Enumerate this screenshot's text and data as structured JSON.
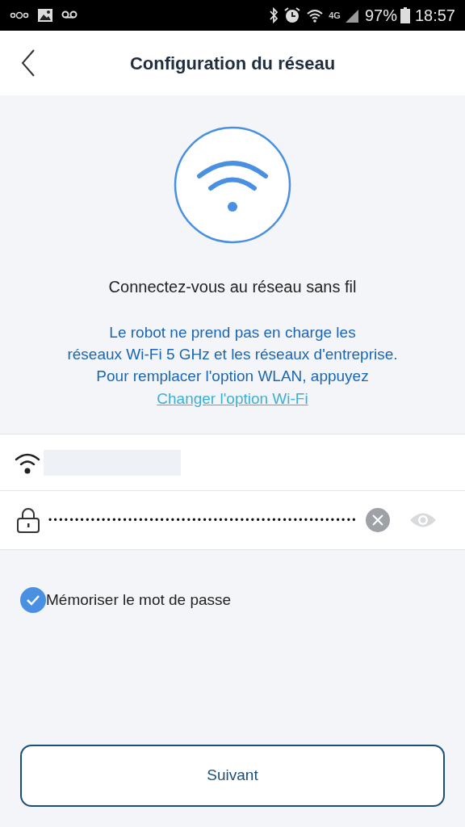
{
  "status_bar": {
    "battery": "97%",
    "time": "18:57",
    "network": "4G"
  },
  "header": {
    "title": "Configuration du réseau"
  },
  "heading": "Connectez-vous au réseau sans fil",
  "notice": [
    "Le robot ne prend pas en charge les",
    "réseaux Wi-Fi 5 GHz et les réseaux d'entreprise.",
    "Pour remplacer l'option WLAN, appuyez"
  ],
  "change_link": "Changer l'option Wi-Fi",
  "password": {
    "value": "••••••••••••••••••••••••••••••••••••••••••••••••••••••••••"
  },
  "remember": {
    "label": "Mémoriser le mot de passe",
    "checked": true
  },
  "next_button": "Suivant"
}
